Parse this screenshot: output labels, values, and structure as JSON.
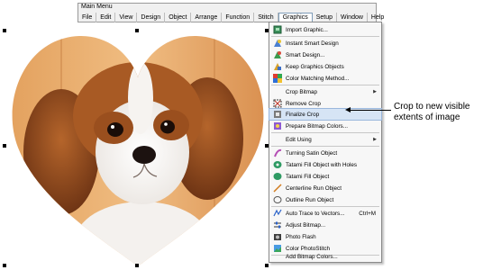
{
  "window": {
    "title": "Main Menu"
  },
  "menubar": {
    "items": [
      "File",
      "Edit",
      "View",
      "Design",
      "Object",
      "Arrange",
      "Function",
      "Stitch",
      "Graphics",
      "Setup",
      "Window",
      "Help"
    ],
    "active": "Graphics"
  },
  "dropdown": {
    "items": [
      {
        "label": "Import Graphic...",
        "icon": "import-graphic-icon"
      },
      {
        "label": "Instant Smart Design",
        "icon": "instant-smart-design-icon"
      },
      {
        "label": "Smart Design...",
        "icon": "smart-design-icon"
      },
      {
        "label": "Keep Graphics Objects",
        "icon": "keep-graphics-icon"
      },
      {
        "label": "Color Matching Method...",
        "icon": "color-matching-icon"
      },
      {
        "label": "Crop Bitmap",
        "icon": "",
        "submenu": true
      },
      {
        "label": "Remove Crop",
        "icon": "remove-crop-icon"
      },
      {
        "label": "Finalize Crop",
        "icon": "finalize-crop-icon",
        "highlighted": true
      },
      {
        "label": "Prepare Bitmap Colors...",
        "icon": "prepare-bitmap-icon"
      },
      {
        "label": "Edit Using",
        "icon": "",
        "submenu": true
      },
      {
        "label": "Turning Satin Object",
        "icon": "turning-satin-icon"
      },
      {
        "label": "Tatami Fill Object with Holes",
        "icon": "tatami-holes-icon"
      },
      {
        "label": "Tatami Fill Object",
        "icon": "tatami-fill-icon"
      },
      {
        "label": "Centerline Run Object",
        "icon": "centerline-run-icon"
      },
      {
        "label": "Outline Run Object",
        "icon": "outline-run-icon"
      },
      {
        "label": "Auto Trace to Vectors...",
        "icon": "auto-trace-icon",
        "shortcut": "Ctrl+M"
      },
      {
        "label": "Adjust Bitmap...",
        "icon": "adjust-bitmap-icon"
      },
      {
        "label": "Photo Flash",
        "icon": "photo-flash-icon"
      },
      {
        "label": "Color PhotoStitch",
        "icon": "color-photostitch-icon"
      },
      {
        "label": "Add Bitmap Colors...",
        "icon": ""
      }
    ]
  },
  "callout": {
    "line1": "Crop to new visible",
    "line2": "extents of image"
  },
  "colors": {
    "highlight": "#d6e4f5",
    "menu_bg": "#f0f0f0"
  }
}
